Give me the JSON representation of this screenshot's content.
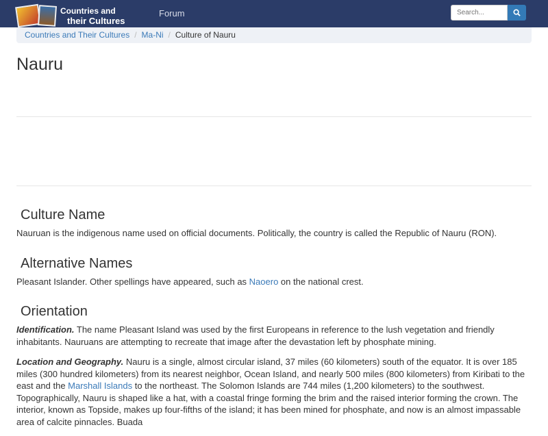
{
  "nav": {
    "logo_line1": "Countries and",
    "logo_line2": "their Cultures",
    "forum": "Forum",
    "search_placeholder": "Search..."
  },
  "breadcrumb": [
    "Countries and Their Cultures",
    "Ma-Ni",
    "Culture of Nauru"
  ],
  "title": "Nauru",
  "sections": {
    "culture_name": {
      "heading": "Culture Name",
      "text": "Nauruan is the indigenous name used on official documents. Politically, the country is called the Republic of Nauru (RON)."
    },
    "alternative_names": {
      "heading": "Alternative Names",
      "text1": "Pleasant Islander. Other spellings have appeared, such as ",
      "link": "Naoero",
      "text2": " on the national crest."
    },
    "orientation": {
      "heading": "Orientation",
      "identification_label": "Identification.",
      "identification_text": " The name Pleasant Island was used by the first Europeans in reference to the lush vegetation and friendly inhabitants. Nauruans are attempting to recreate that image after the devastation left by phosphate mining.",
      "location_label": "Location and Geography.",
      "location_text1": " Nauru is a single, almost circular island, 37 miles (60 kilometers) south of the equator. It is over 185 miles (300 hundred kilometers) from its nearest neighbor, Ocean Island, and nearly 500 miles (800 kilometers) from Kiribati to the east and the ",
      "location_link": "Marshall Islands",
      "location_text2": " to the northeast. The Solomon Islands are 744 miles (1,200 kilometers) to the southwest. Topographically, Nauru is shaped like a hat, with a coastal fringe forming the brim and the raised interior forming the crown. The interior, known as Topside, makes up four-fifths of the island; it has been mined for phosphate, and now is an almost impassable area of calcite pinnacles. Buada"
    }
  }
}
